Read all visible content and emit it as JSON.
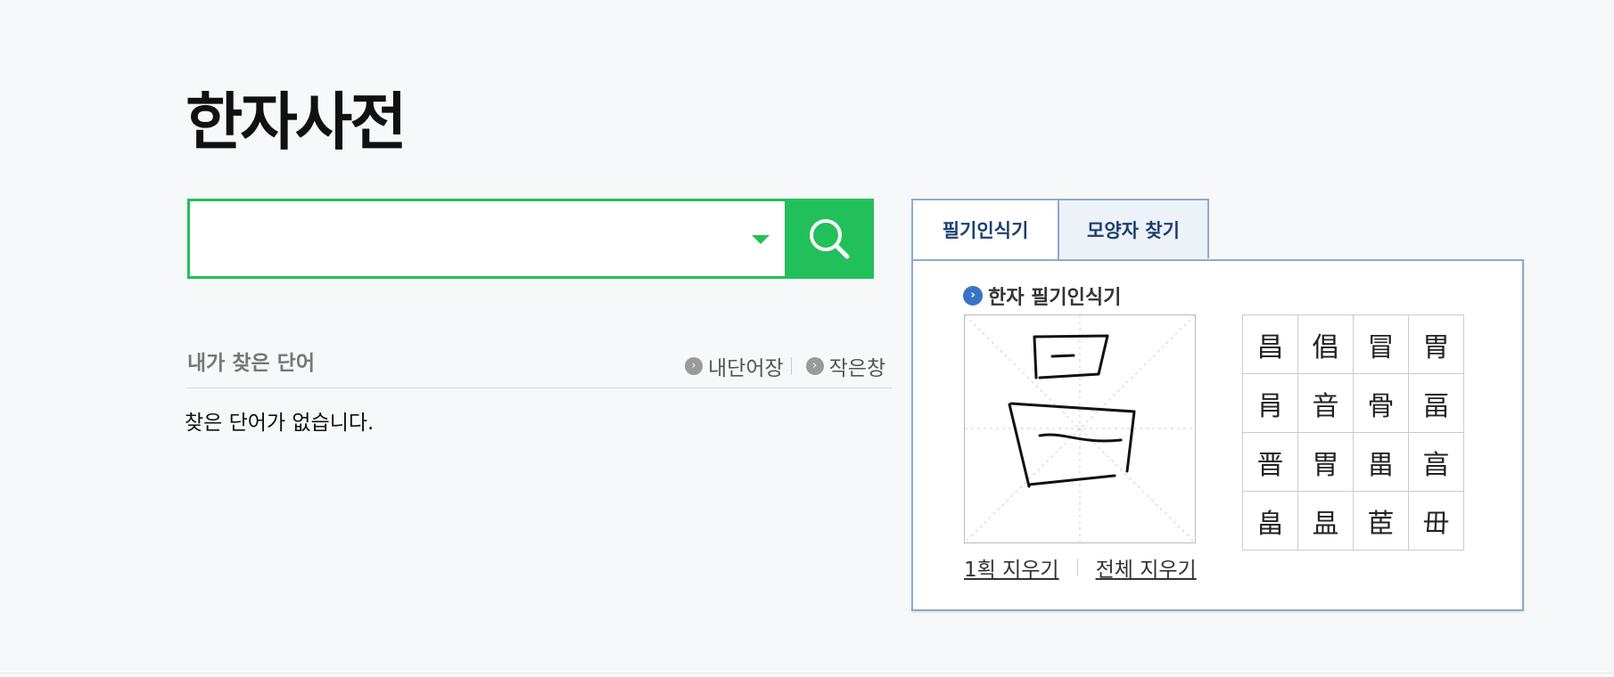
{
  "page_title": "한자사전",
  "search": {
    "value": "",
    "placeholder": ""
  },
  "recent": {
    "title": "내가 찾은 단어",
    "links": [
      "내단어장",
      "작은창"
    ],
    "empty_message": "찾은 단어가 없습니다."
  },
  "panel": {
    "tabs": [
      "필기인식기",
      "모양자 찾기"
    ],
    "active_tab": 0,
    "heading": "한자 필기인식기",
    "clear_links": [
      "1획 지우기",
      "전체 지우기"
    ],
    "candidates": [
      "昌",
      "倡",
      "冒",
      "胃",
      "肙",
      "音",
      "骨",
      "畐",
      "晋",
      "胃",
      "畕",
      "亯",
      "畠",
      "昷",
      "茞",
      "毌"
    ]
  },
  "colors": {
    "accent": "#22c05b",
    "panel_border": "#8fabcb",
    "tab_text": "#1d3e70"
  }
}
